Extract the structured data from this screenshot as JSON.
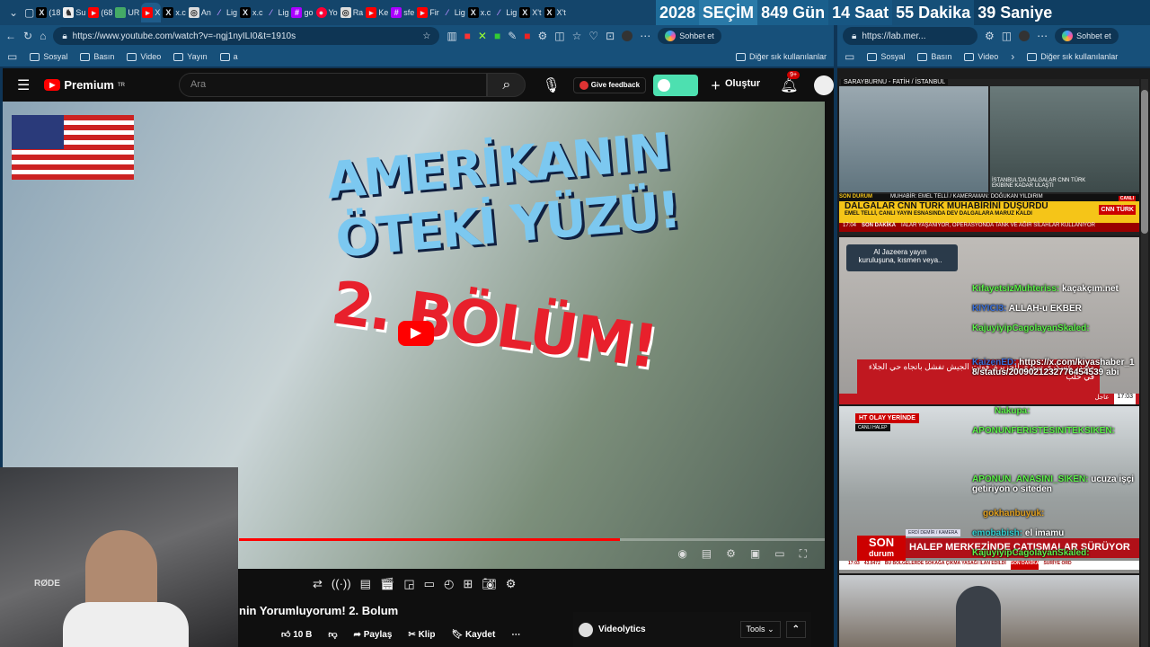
{
  "tabs": [
    {
      "icon": "x",
      "label": "(18"
    },
    {
      "icon": "lichess",
      "label": "Su"
    },
    {
      "icon": "youtube",
      "label": "(68"
    },
    {
      "icon": "game",
      "label": "UR"
    },
    {
      "icon": "youtube",
      "label": "X",
      "active": true
    },
    {
      "icon": "x",
      "label": "x.c"
    },
    {
      "icon": "openai",
      "label": "An"
    },
    {
      "icon": "feather",
      "label": "Lig"
    },
    {
      "icon": "x",
      "label": "x.c"
    },
    {
      "icon": "feather",
      "label": "Lig"
    },
    {
      "icon": "hash",
      "label": "go"
    },
    {
      "icon": "music",
      "label": "Yo"
    },
    {
      "icon": "openai",
      "label": "Ra"
    },
    {
      "icon": "youtube",
      "label": "Ke"
    },
    {
      "icon": "hash",
      "label": "sfe"
    },
    {
      "icon": "youtube",
      "label": "Fir"
    },
    {
      "icon": "feather",
      "label": "Lig"
    },
    {
      "icon": "x",
      "label": "x.c"
    },
    {
      "icon": "feather",
      "label": "Lig"
    },
    {
      "icon": "x",
      "label": "X't"
    },
    {
      "icon": "x",
      "label": "X't"
    }
  ],
  "countdown": [
    "2028",
    "SEÇİM",
    "849 Gün",
    "14 Saat",
    "55 Dakika",
    "39 Saniye"
  ],
  "left_browser": {
    "url": "https://www.youtube.com/watch?v=-ngj1nyILI0&t=1910s",
    "copilot": "Sohbet et",
    "bookmarks": [
      "Sosyal",
      "Basın",
      "Video",
      "Yayın",
      "a"
    ],
    "other_bookmarks": "Diğer sık kullanılanlar"
  },
  "right_browser": {
    "url": "https://lab.mer...",
    "copilot": "Sohbet et",
    "bookmarks": [
      "Sosyal",
      "Basın",
      "Video"
    ],
    "other_bookmarks": "Diğer sık kullanılanlar"
  },
  "youtube": {
    "logo": "Premium",
    "logo_badge": "TR",
    "search_placeholder": "Ara",
    "feedback": "Give feedback",
    "create": "Oluştur",
    "notif_count": "9+",
    "thumb_line1": "AMERİKANIN",
    "thumb_line2": "ÖTEKİ YÜZÜ!",
    "thumb_line3": "2. BÖLÜM!",
    "progress_percent": 65,
    "title": "nin Yorumluyorum! 2. Bolum",
    "likes": "10 B",
    "share": "Paylaş",
    "clip": "Klip",
    "save": "Kaydet",
    "videolytics": "Videolytics",
    "tools": "Tools"
  },
  "webcam": {
    "mic_brand": "RØDE"
  },
  "feeds": {
    "cnn": {
      "location": "SARAYBURNU - FATİH / İSTANBUL",
      "inset": "İSTANBUL'DA DALGALAR CNN TÜRK EKİBİNE KADAR ULAŞTI",
      "tag": "SON DURUM",
      "credit": "MUHABİR: EMEL TELLİ / KAMERAMAN: DOĞUKAN YILDIRIM",
      "headline": "DALGALAR CNN TÜRK MUHABİRİNİ DÜŞÜRDÜ",
      "sub": "EMEL TELLİ, CANLI YAYIN ESNASINDA DEV DALGALARA MARUZ KALDI",
      "time": "17:04",
      "ticker_tag": "SON DAKİKA",
      "ticker": "IALAR YAŞANIYOR, OPERASYONDA TANK VE AĞIR SİLAHLAR KULLANIYOR",
      "brand": "CNN TÜRK",
      "live": "CANLI"
    },
    "aljazeera": {
      "notice": "Al Jazeera yayın kuruluşuna, kısmen veya..",
      "breaking_ar": "مصدر عسكري سوري للجزيرة: قوات الجيش تفشل باتجاه حي الجلاء في حلب",
      "ticker_tag": "عاجل",
      "time": "17:03"
    },
    "ht": {
      "tag": "HT OLAY YERİNDE",
      "live": "CANLI HALEP",
      "credit": "ERDİ DEMİR / KAMERA",
      "son": "SON",
      "durum": "durum",
      "headline": "HALEP MERKEZİNDE ÇATIŞMALAR SÜRÜYOR",
      "ticker": "BU BÖLGELERDE SOKAĞA ÇIKMA YASAĞI İLAN EDİLDİ",
      "time": "17:03",
      "rate": "43.0472",
      "ticker_tag": "SON DAKİKA",
      "ticker2": "SURİYE ORD"
    }
  },
  "chat": [
    {
      "user": "KifayetsizMuhteriss:",
      "text": "kaçakçım.net",
      "color": "#5cf04a"
    },
    {
      "user": "KIYICI3:",
      "text": "ALLAH-u EKBER",
      "color": "#3a6fd8"
    },
    {
      "user": "KajuyiyipCagolayanSkaled:",
      "text": "",
      "color": "#5cf04a"
    },
    {
      "user": "KaizenED:",
      "text": "https://x.com/kiyashaber_18/status/2009021232776454539 abi",
      "color": "#3a6fd8"
    },
    {
      "user": "Nakupa:",
      "text": "",
      "color": "#5cf04a"
    },
    {
      "user": "APONUNFERISTESINITEKSIKEN:",
      "text": "",
      "color": "#5cf04a"
    },
    {
      "user": "APONUN_ANASINI_SIKEN:",
      "text": "ucuza işçi getiriyon o siteden",
      "color": "#5cf04a"
    },
    {
      "user": "gokhanbuyuk:",
      "text": "",
      "color": "#e0a020"
    },
    {
      "user": "emobabish:",
      "text": "el imamu",
      "color": "#30d0d0"
    },
    {
      "user": "KajuyiyipCagolayanSkaled:",
      "text": "",
      "color": "#5cf04a"
    }
  ]
}
